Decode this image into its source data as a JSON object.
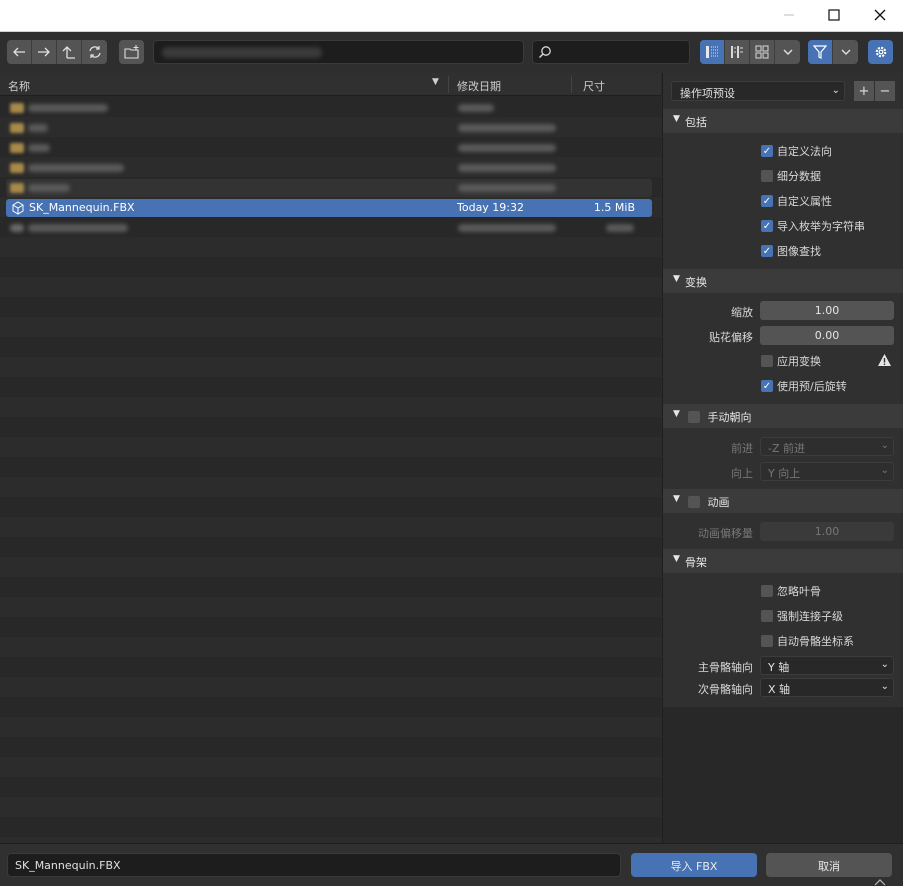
{
  "titlebar": {
    "minimize_icon": "minimize-icon",
    "maximize_icon": "maximize-icon",
    "close_icon": "close-icon"
  },
  "toolbar": {
    "search_placeholder": "",
    "path_value": ""
  },
  "list": {
    "headers": {
      "name": "名称",
      "date": "修改日期",
      "size": "尺寸"
    },
    "selected_file": {
      "name": "SK_Mannequin.FBX",
      "date": "Today 19:32",
      "size": "1.5 MiB"
    }
  },
  "panel": {
    "preset_label": "操作项预设",
    "add_label": "+",
    "remove_label": "−",
    "sections": {
      "include": "包括",
      "transform": "变换",
      "manual_orient": "手动朝向",
      "animation": "动画",
      "armature": "骨架"
    },
    "include": {
      "custom_normals": "自定义法向",
      "subdivision": "细分数据",
      "custom_props": "自定义属性",
      "enum_as_string": "导入枚举为字符串",
      "image_search": "图像查找"
    },
    "transform": {
      "scale_label": "缩放",
      "scale_value": "1.00",
      "decal_label": "贴花偏移",
      "decal_value": "0.00",
      "apply_transform": "应用变换",
      "use_prepost": "使用预/后旋转"
    },
    "orient": {
      "forward_label": "前进",
      "forward_value": "-Z 前进",
      "up_label": "向上",
      "up_value": "Y 向上"
    },
    "anim": {
      "offset_label": "动画偏移量",
      "offset_value": "1.00"
    },
    "armature": {
      "ignore_leaf": "忽略叶骨",
      "force_connect": "强制连接子级",
      "auto_bone": "自动骨骼坐标系",
      "primary_label": "主骨骼轴向",
      "primary_value": "Y 轴",
      "secondary_label": "次骨骼轴向",
      "secondary_value": "X 轴"
    }
  },
  "bottom": {
    "filename": "SK_Mannequin.FBX",
    "import_label": "导入 FBX",
    "cancel_label": "取消"
  },
  "colors": {
    "accent": "#4772b3",
    "background": "#282828",
    "panel": "#303030"
  }
}
